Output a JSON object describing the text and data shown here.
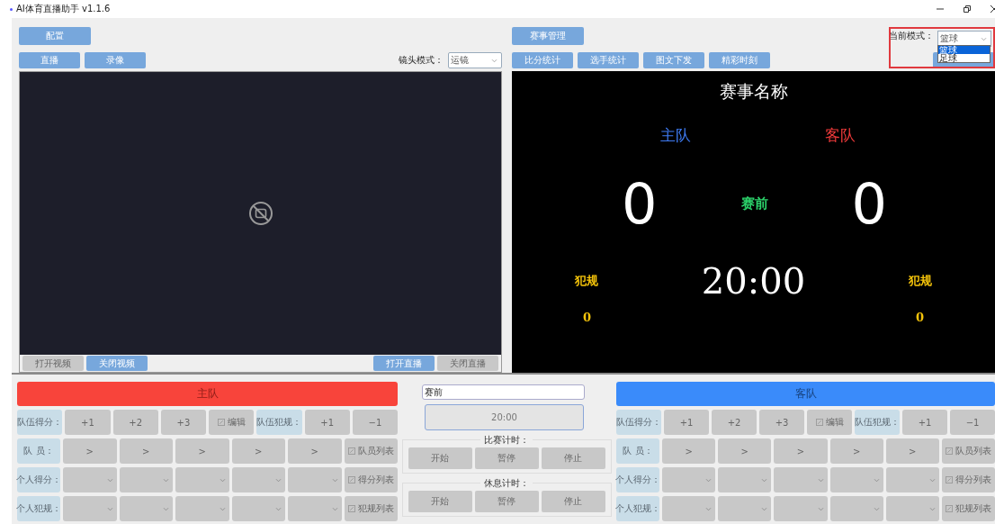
{
  "window": {
    "title": "AI体育直播助手 v1.1.6"
  },
  "left": {
    "config_button": "配置",
    "source_buttons": [
      "直播",
      "录像"
    ],
    "camera_mode": {
      "label": "镜头模式：",
      "value": "运镜"
    },
    "video_buttons": [
      {
        "label": "打开视频",
        "disabled": true
      },
      {
        "label": "关闭视频",
        "disabled": false
      },
      {
        "label": "打开直播",
        "disabled": false
      },
      {
        "label": "关闭直播",
        "disabled": true
      }
    ]
  },
  "right": {
    "manage_button": "赛事管理",
    "stats_buttons": [
      "比分统计",
      "选手统计",
      "图文下发",
      "精彩时刻"
    ],
    "mode": {
      "label": "当前模式：",
      "value": "篮球",
      "options": [
        {
          "label": "篮球",
          "selected": true
        },
        {
          "label": "足球",
          "selected": false
        }
      ]
    }
  },
  "scoreboard": {
    "title": "赛事名称",
    "home_name": "主队",
    "away_name": "客队",
    "home_score": "0",
    "status": "赛前",
    "away_score": "0",
    "home_foul_label": "犯规",
    "clock": "20:00",
    "away_foul_label": "犯规",
    "home_fouls": "0",
    "away_fouls": "0"
  },
  "teams": [
    {
      "name": "主队",
      "color": "#f8443b",
      "score_label": "队伍得分：",
      "score_buttons": [
        "+1",
        "+2",
        "+3"
      ],
      "edit_button": "编辑",
      "foul_label": "队伍犯规：",
      "foul_buttons": [
        "+1",
        "−1"
      ],
      "player_label": "队 员：",
      "player_buttons": [
        ">",
        ">",
        ">",
        ">",
        ">"
      ],
      "player_list": "队员列表",
      "personal_score_label": "个人得分：",
      "score_list": "得分列表",
      "personal_foul_label": "个人犯规：",
      "foul_list": "犯规列表"
    },
    {
      "name": "客队",
      "color": "#3a8bfa",
      "score_label": "队伍得分：",
      "score_buttons": [
        "+1",
        "+2",
        "+3"
      ],
      "edit_button": "编辑",
      "foul_label": "队伍犯规：",
      "foul_buttons": [
        "+1",
        "−1"
      ],
      "player_label": "队 员：",
      "player_buttons": [
        ">",
        ">",
        ">",
        ">",
        ">"
      ],
      "player_list": "队员列表",
      "personal_score_label": "个人得分：",
      "score_list": "得分列表",
      "personal_foul_label": "个人犯规：",
      "foul_list": "犯规列表"
    }
  ],
  "center": {
    "status_input": "赛前",
    "clock": "20:00",
    "timers": [
      {
        "legend": "比赛计时：",
        "buttons": [
          "开始",
          "暂停",
          "停止"
        ]
      },
      {
        "legend": "休息计时：",
        "buttons": [
          "开始",
          "暂停",
          "停止"
        ]
      }
    ]
  }
}
